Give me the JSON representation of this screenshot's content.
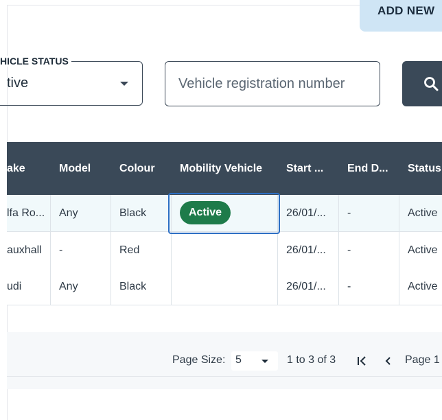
{
  "toolbar": {
    "add_new_label": "ADD NEW",
    "status_filter_label": "HICLE STATUS",
    "status_filter_value": "tive",
    "registration_placeholder": "Vehicle registration number"
  },
  "grid": {
    "columns": [
      "ake",
      "Model",
      "Colour",
      "Mobility Vehicle",
      "Start ...",
      "End D...",
      "Status"
    ],
    "rows": [
      {
        "make": "lfa Ro...",
        "model": "Any",
        "colour": "Black",
        "mobility": "Active",
        "start": "26/01/...",
        "end": "-",
        "status": "Active"
      },
      {
        "make": "auxhall",
        "model": "-",
        "colour": "Red",
        "mobility": "",
        "start": "26/01/...",
        "end": "-",
        "status": "Active"
      },
      {
        "make": "udi",
        "model": "Any",
        "colour": "Black",
        "mobility": "",
        "start": "26/01/...",
        "end": "-",
        "status": "Active"
      }
    ]
  },
  "pagination": {
    "page_size_label": "Page Size:",
    "page_size_value": "5",
    "range_text": "1 to 3 of 3",
    "page_text": "Page 1"
  },
  "icons": {
    "search": "search-icon",
    "first_page": "first-page-icon",
    "previous_page": "previous-page-icon",
    "dropdown": "chevron-down-icon"
  },
  "colors": {
    "header_bg": "#3a4958",
    "active_badge": "#1e7b4a",
    "add_new_bg": "#cfe5f5",
    "focus_border": "#2d6fc4",
    "alt_row": "#f1f9fb"
  }
}
